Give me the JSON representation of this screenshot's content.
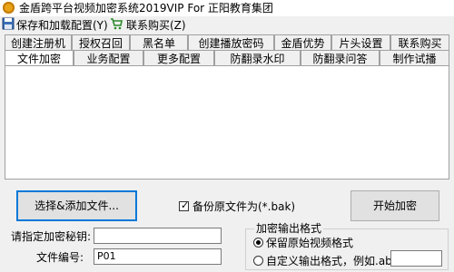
{
  "window": {
    "title": "金盾跨平台视频加密系统2019VIP For 正阳教育集团"
  },
  "menu": {
    "save_config": "保存和加载配置(Y)",
    "buy": "联系购买(Z)"
  },
  "tabs": {
    "row1": [
      "创建注册机",
      "授权召回",
      "黑名单",
      "创建播放密码",
      "金盾优势",
      "片头设置",
      "联系购买"
    ],
    "row2": [
      "文件加密",
      "业务配置",
      "更多配置",
      "防翻录水印",
      "防翻录问答",
      "制作试播"
    ]
  },
  "file_encrypt": {
    "add_file_button": "选择&添加文件...",
    "backup_label": "备份原文件为(*.bak)",
    "backup_checked": true,
    "start_button": "开始加密",
    "key_label": "请指定加密秘钥:",
    "key_value": "",
    "file_no_label": "文件编号:",
    "file_no_value": "P01",
    "output_group_title": "加密输出格式",
    "keep_format_label": "保留原始视频格式",
    "custom_format_label": "自定义输出格式，例如.abc",
    "custom_format_value": "",
    "selected_format": "keep"
  }
}
